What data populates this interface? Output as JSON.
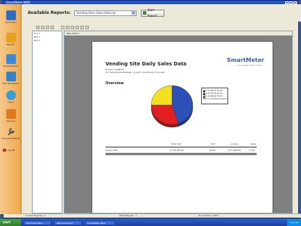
{
  "window": {
    "title": "SmartMeter MMS"
  },
  "sidebar": {
    "items": [
      {
        "label": "Dashboard",
        "icon": "dashboard-icon",
        "color": "#2a6fc4"
      },
      {
        "label": "Reports",
        "icon": "folder-icon",
        "color": "#e8a020"
      },
      {
        "label": "Vending Points",
        "icon": "vending-icon",
        "color": "#3a8ad8"
      },
      {
        "label": "Bulk Operations",
        "icon": "bulk-icon",
        "color": "#2e86c8"
      },
      {
        "label": "Users",
        "icon": "users-icon",
        "color": "#3a9ed8"
      },
      {
        "label": "Sessions",
        "icon": "sessions-icon",
        "color": "#e07a20"
      },
      {
        "label": "Tools and Settings",
        "icon": "wrench-icon",
        "color": "#707070"
      },
      {
        "label": "Log Off",
        "icon": "logoff-icon",
        "color": "#c03030"
      }
    ]
  },
  "reportbar": {
    "title": "Available Reports:",
    "selected": "Vending Sites Sales Data.rpt",
    "start_label": "Start Report"
  },
  "tree": {
    "items": [
      "⊟-0 1",
      "⊞-0 1",
      "⊞-0 1"
    ]
  },
  "preview": {
    "tab": "Main Report"
  },
  "report": {
    "title": "Vending Site Daily Sales Data",
    "logo": "SmartMeter",
    "tagline": "The Intelligent Meter Solution",
    "meta_lines": [
      "Printed:  12/08/07",
      "For Transactions Between:    1/12/07   and   8/12/07    Inclusive"
    ],
    "section": "Overview",
    "legend": [
      {
        "color": "#2d4fb8",
        "text": "$ 79,360.00   45.0%"
      },
      {
        "color": "#e02020",
        "text": "$ 52,907.00   30.0%"
      },
      {
        "color": "#f0e020",
        "text": "$ 44,088.00   25.0%"
      },
      {
        "color": "#ffffff",
        "text": "Total:  $ 176,355.00  100.0%"
      }
    ],
    "totals_headers": [
      "Total Sold",
      "GST",
      "Arrears",
      "Sales"
    ],
    "totals_label": "Grand Total:",
    "totals_values": [
      "$ 176,355.00",
      "$0.00",
      "$ 11,000.00",
      "1,751"
    ]
  },
  "chart_data": {
    "type": "pie",
    "title": "",
    "categories": [
      "Blue",
      "Red",
      "Yellow"
    ],
    "values": [
      45.0,
      30.0,
      25.0
    ],
    "colors": [
      "#2d4fb8",
      "#e02020",
      "#f0e020"
    ]
  },
  "statusbar": {
    "left": "Current Page No.: 1",
    "mid": "Total Page No.: 1",
    "right": "Zoom Factor: 100%"
  },
  "taskbar": {
    "start": "start",
    "tasks": [
      "Microsoft Office",
      "Microsoft Excel",
      "SmartMeter MMS"
    ],
    "clock": "5:21 PM"
  }
}
